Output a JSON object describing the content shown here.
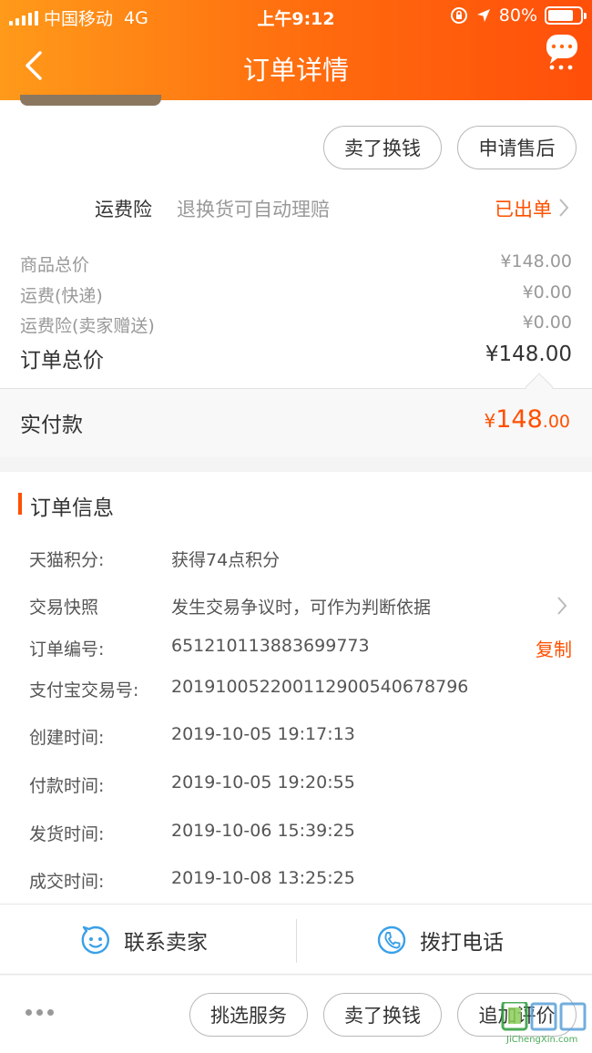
{
  "status_bar": {
    "carrier": "中国移动",
    "network": "4G",
    "time": "上午9:12",
    "battery": "80%",
    "battery_level": 0.8
  },
  "nav": {
    "title": "订单详情",
    "back_icon": "chevron-left-icon",
    "more_icon": "more-bubble-icon"
  },
  "actions_top": [
    "卖了换钱",
    "申请售后"
  ],
  "insurance": {
    "label": "运费险",
    "desc": "退换货可自动理赔",
    "status": "已出单"
  },
  "fees": [
    {
      "label": "商品总价",
      "value": "¥148.00"
    },
    {
      "label": "运费(快递)",
      "value": "¥0.00"
    },
    {
      "label": "运费险(卖家赠送)",
      "value": "¥0.00"
    }
  ],
  "order_total": {
    "label": "订单总价",
    "value": "¥148.00"
  },
  "paid": {
    "label": "实付款",
    "currency": "¥",
    "int": "148",
    "dec": ".00"
  },
  "order_info": {
    "title": "订单信息",
    "rows": [
      {
        "k": "天猫积分:",
        "v": "获得74点积分"
      },
      {
        "k": "交易快照",
        "v": "发生交易争议时，可作为判断依据"
      },
      {
        "k": "订单编号:",
        "v": "651210113883699773"
      },
      {
        "k": "支付宝交易号:",
        "v": "2019100522001129005406787​96"
      },
      {
        "k": "创建时间:",
        "v": "2019-10-05 19:17:13"
      },
      {
        "k": "付款时间:",
        "v": "2019-10-05 19:20:55"
      },
      {
        "k": "发货时间:",
        "v": "2019-10-06 15:39:25"
      },
      {
        "k": "成交时间:",
        "v": "2019-10-08 13:25:25"
      }
    ],
    "copy_label": "复制"
  },
  "contact": {
    "seller": "联系卖家",
    "phone": "拨打电话"
  },
  "bottom_actions": [
    "挑选服务",
    "卖了换钱",
    "追加评价"
  ],
  "colors": {
    "accent": "#ff5000",
    "header_start": "#ff9a1a",
    "header_end": "#ff4f0a",
    "icon_blue": "#3aa0e8"
  }
}
